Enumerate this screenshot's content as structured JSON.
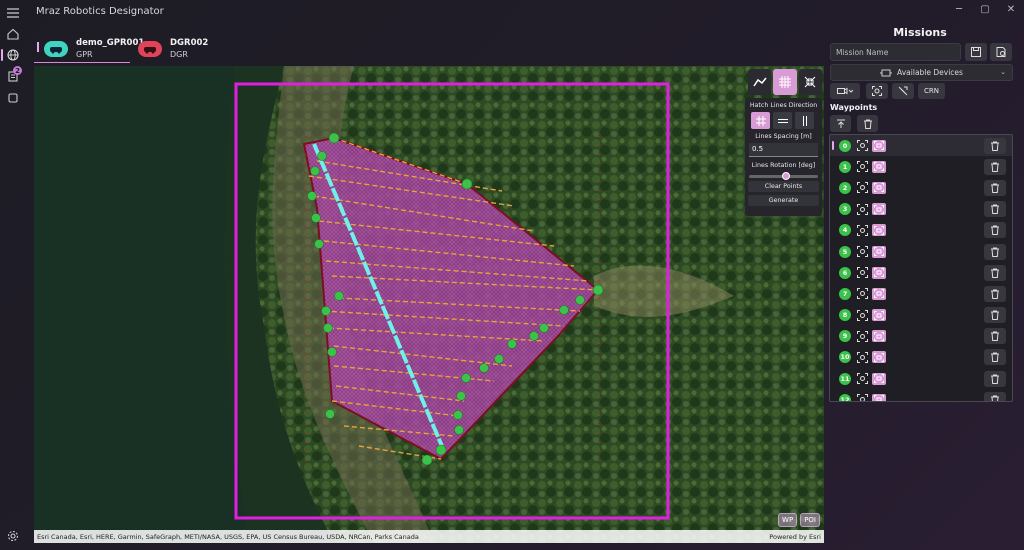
{
  "app": {
    "title": "Mraz Robotics Designator"
  },
  "rail": {
    "items": [
      "menu-icon",
      "home-icon",
      "globe-icon",
      "clipboard-icon",
      "square-icon",
      "settings-icon"
    ],
    "badge_count": "2"
  },
  "devices": [
    {
      "name": "demo_GPR001",
      "type": "GPR",
      "color": "#3fd3c0"
    },
    {
      "name": "DGR002",
      "type": "DGR",
      "color": "#e0435a"
    }
  ],
  "map": {
    "attribution": "Esri Canada, Esri, HERE, Garmin, SafeGraph, METI/NASA, USGS, EPA, US Census Bureau, USDA, NRCan, Parks Canada",
    "powered_by": "Powered by Esri",
    "chips": {
      "wp": "WP",
      "poi": "POI"
    }
  },
  "hatch_panel": {
    "direction_label": "Hatch Lines Direction",
    "spacing_label": "Lines Spacing [m]",
    "spacing_value": "0.5",
    "rotation_label": "Lines Rotation [deg]",
    "clear_label": "Clear Points",
    "generate_label": "Generate"
  },
  "missions": {
    "title": "Missions",
    "name_placeholder": "Mission Name",
    "devices_label": "Available Devices",
    "crn_label": "CRN",
    "waypoints_label": "Waypoints",
    "waypoints": [
      "0",
      "1",
      "2",
      "3",
      "4",
      "5",
      "6",
      "7",
      "8",
      "9",
      "10",
      "11",
      "12"
    ]
  },
  "colors": {
    "accent": "#d89bd6",
    "waypoint": "#3cc24a",
    "boundary": "#e020e0",
    "polygon": "#b03a9a"
  }
}
